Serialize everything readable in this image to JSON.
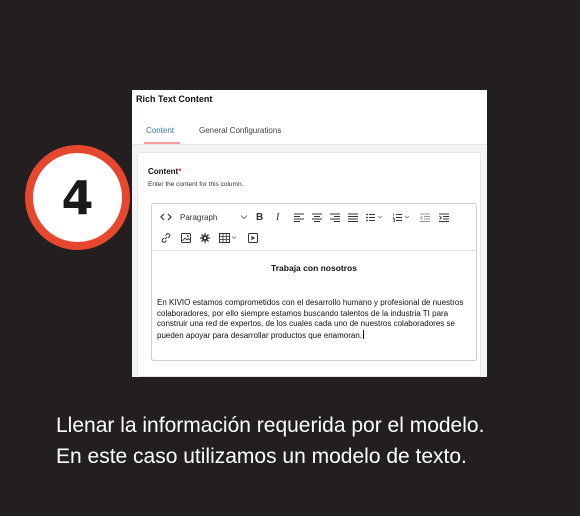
{
  "step": {
    "number": "4"
  },
  "panel": {
    "title": "Rich Text Content",
    "tabs": [
      {
        "label": "Content",
        "active": true
      },
      {
        "label": "General Configurations",
        "active": false
      }
    ],
    "field": {
      "label": "Content",
      "required_mark": "*",
      "help": "Enter the content for this column."
    },
    "editor": {
      "toolbar": {
        "row1": [
          "code-icon",
          "paragraph-select",
          "bold-icon",
          "italic-icon",
          "align-left-icon",
          "align-center-icon",
          "align-right-icon",
          "align-justify-icon",
          "bullet-list-icon",
          "numbered-list-icon",
          "outdent-icon",
          "indent-icon"
        ],
        "row2": [
          "link-icon",
          "image-icon",
          "gear-icon",
          "table-icon",
          "video-icon"
        ],
        "paragraph_value": "Paragraph",
        "bold_label": "B",
        "italic_label": "I"
      },
      "heading": "Trabaja con nosotros",
      "paragraph": "En KIVIO estamos comprometidos con el desarrollo humano y profesional de nuestros colaboradores, por ello siempre estamos buscando talentos de la industria TI para construir una red de expertos, de los cuales cada uno de nuestros colaboradores se pueden apoyar para desarrollar productos que enamoran."
    }
  },
  "instruction": "Llenar la información requerida por el modelo. En este caso utilizamos un modelo de texto.",
  "colors": {
    "background": "#231f20",
    "badge_ring": "#e8472f",
    "active_tab": "#3a6fb0",
    "required": "#dd3333"
  }
}
